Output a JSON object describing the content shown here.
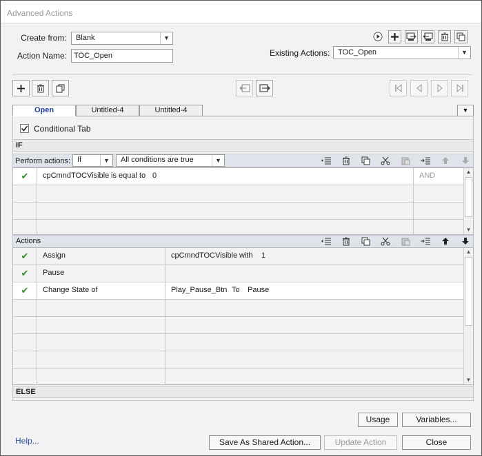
{
  "window": {
    "title": "Advanced Actions"
  },
  "create_from": {
    "label": "Create from:",
    "value": "Blank"
  },
  "action_name": {
    "label": "Action Name:",
    "value": "TOC_Open"
  },
  "existing_actions": {
    "label": "Existing Actions:",
    "value": "TOC_Open"
  },
  "tabs": [
    {
      "label": "Open"
    },
    {
      "label": "Untitled-4"
    },
    {
      "label": "Untitled-4"
    }
  ],
  "conditional_tab": {
    "label": "Conditional Tab",
    "checked": true
  },
  "if_section": {
    "header": "IF",
    "perform_label": "Perform actions:",
    "perform_value": "If",
    "condition_mode": "All conditions are true",
    "rows": [
      {
        "checked": true,
        "variable": "cpCmndTOCVisible",
        "operator": "is equal to",
        "value": "0",
        "logic": "AND"
      }
    ]
  },
  "actions_section": {
    "header": "Actions",
    "rows": [
      {
        "checked": true,
        "action": "Assign",
        "target": "cpCmndTOCVisible",
        "keyword": "with",
        "value": "1"
      },
      {
        "checked": true,
        "action": "Pause",
        "target": "",
        "keyword": "",
        "value": ""
      },
      {
        "checked": true,
        "action": "Change State of",
        "target": "Play_Pause_Btn",
        "keyword": "To",
        "value": "Pause"
      }
    ]
  },
  "else_section": {
    "header": "ELSE"
  },
  "footer": {
    "usage": "Usage",
    "variables": "Variables...",
    "help": "Help...",
    "save_shared": "Save As Shared Action...",
    "update": "Update Action",
    "close": "Close"
  },
  "colors": {
    "active_tab_text": "#1c3d9c",
    "check_green": "#2e8b2e",
    "link_blue": "#2855a8"
  }
}
